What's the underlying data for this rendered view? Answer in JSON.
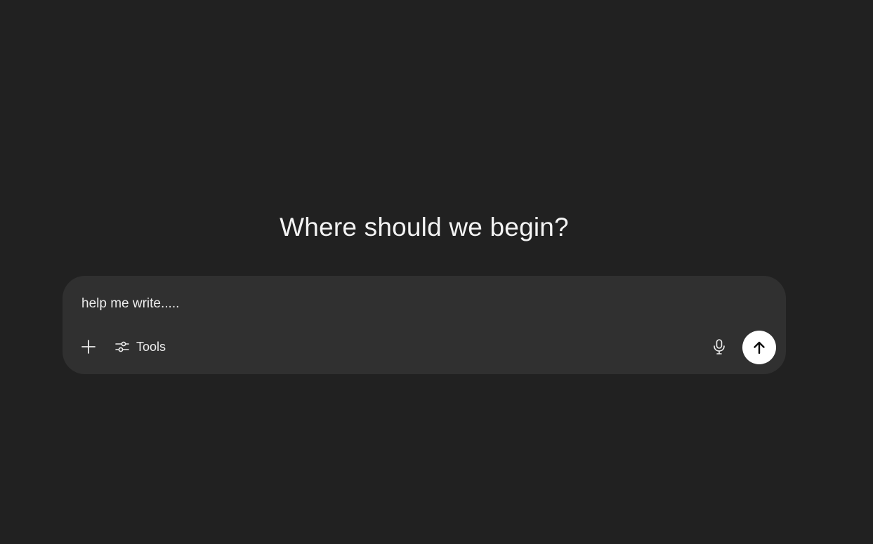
{
  "headline": "Where should we begin?",
  "composer": {
    "input_value": "help me write.....",
    "tools_label": "Tools",
    "icons": {
      "add": "plus-icon",
      "tools": "sliders-icon",
      "mic": "microphone-icon",
      "send": "arrow-up-icon"
    }
  },
  "colors": {
    "background": "#212121",
    "composer": "#303030",
    "text": "#ececec",
    "send_button": "#ffffff"
  }
}
